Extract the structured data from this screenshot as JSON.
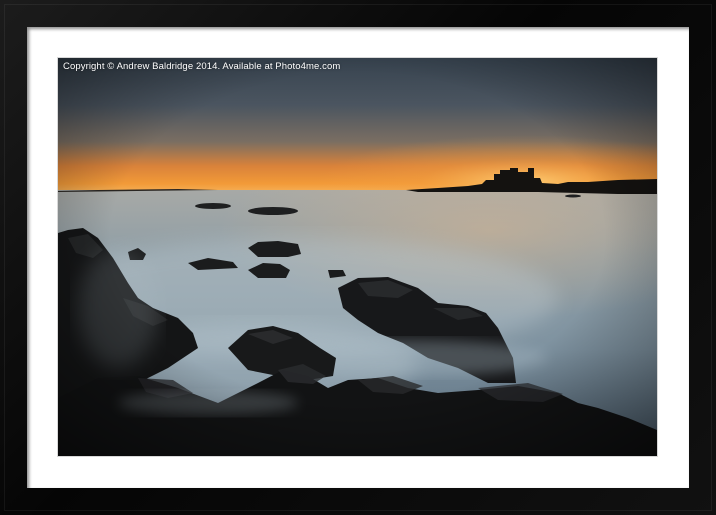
{
  "watermark": {
    "text": "Copyright © Andrew Baldridge 2014. Available at Photo4me.com"
  },
  "scene": {
    "subject": "castle-silhouette-at-sunset-over-misty-sea",
    "colors": {
      "frame": "#0b0b0b",
      "mount": "#ffffff",
      "sky_top": "#3b4854",
      "sky_glow": "#f08a2a",
      "sea": "#9aaab4",
      "rocks": "#1a1a1a"
    }
  }
}
